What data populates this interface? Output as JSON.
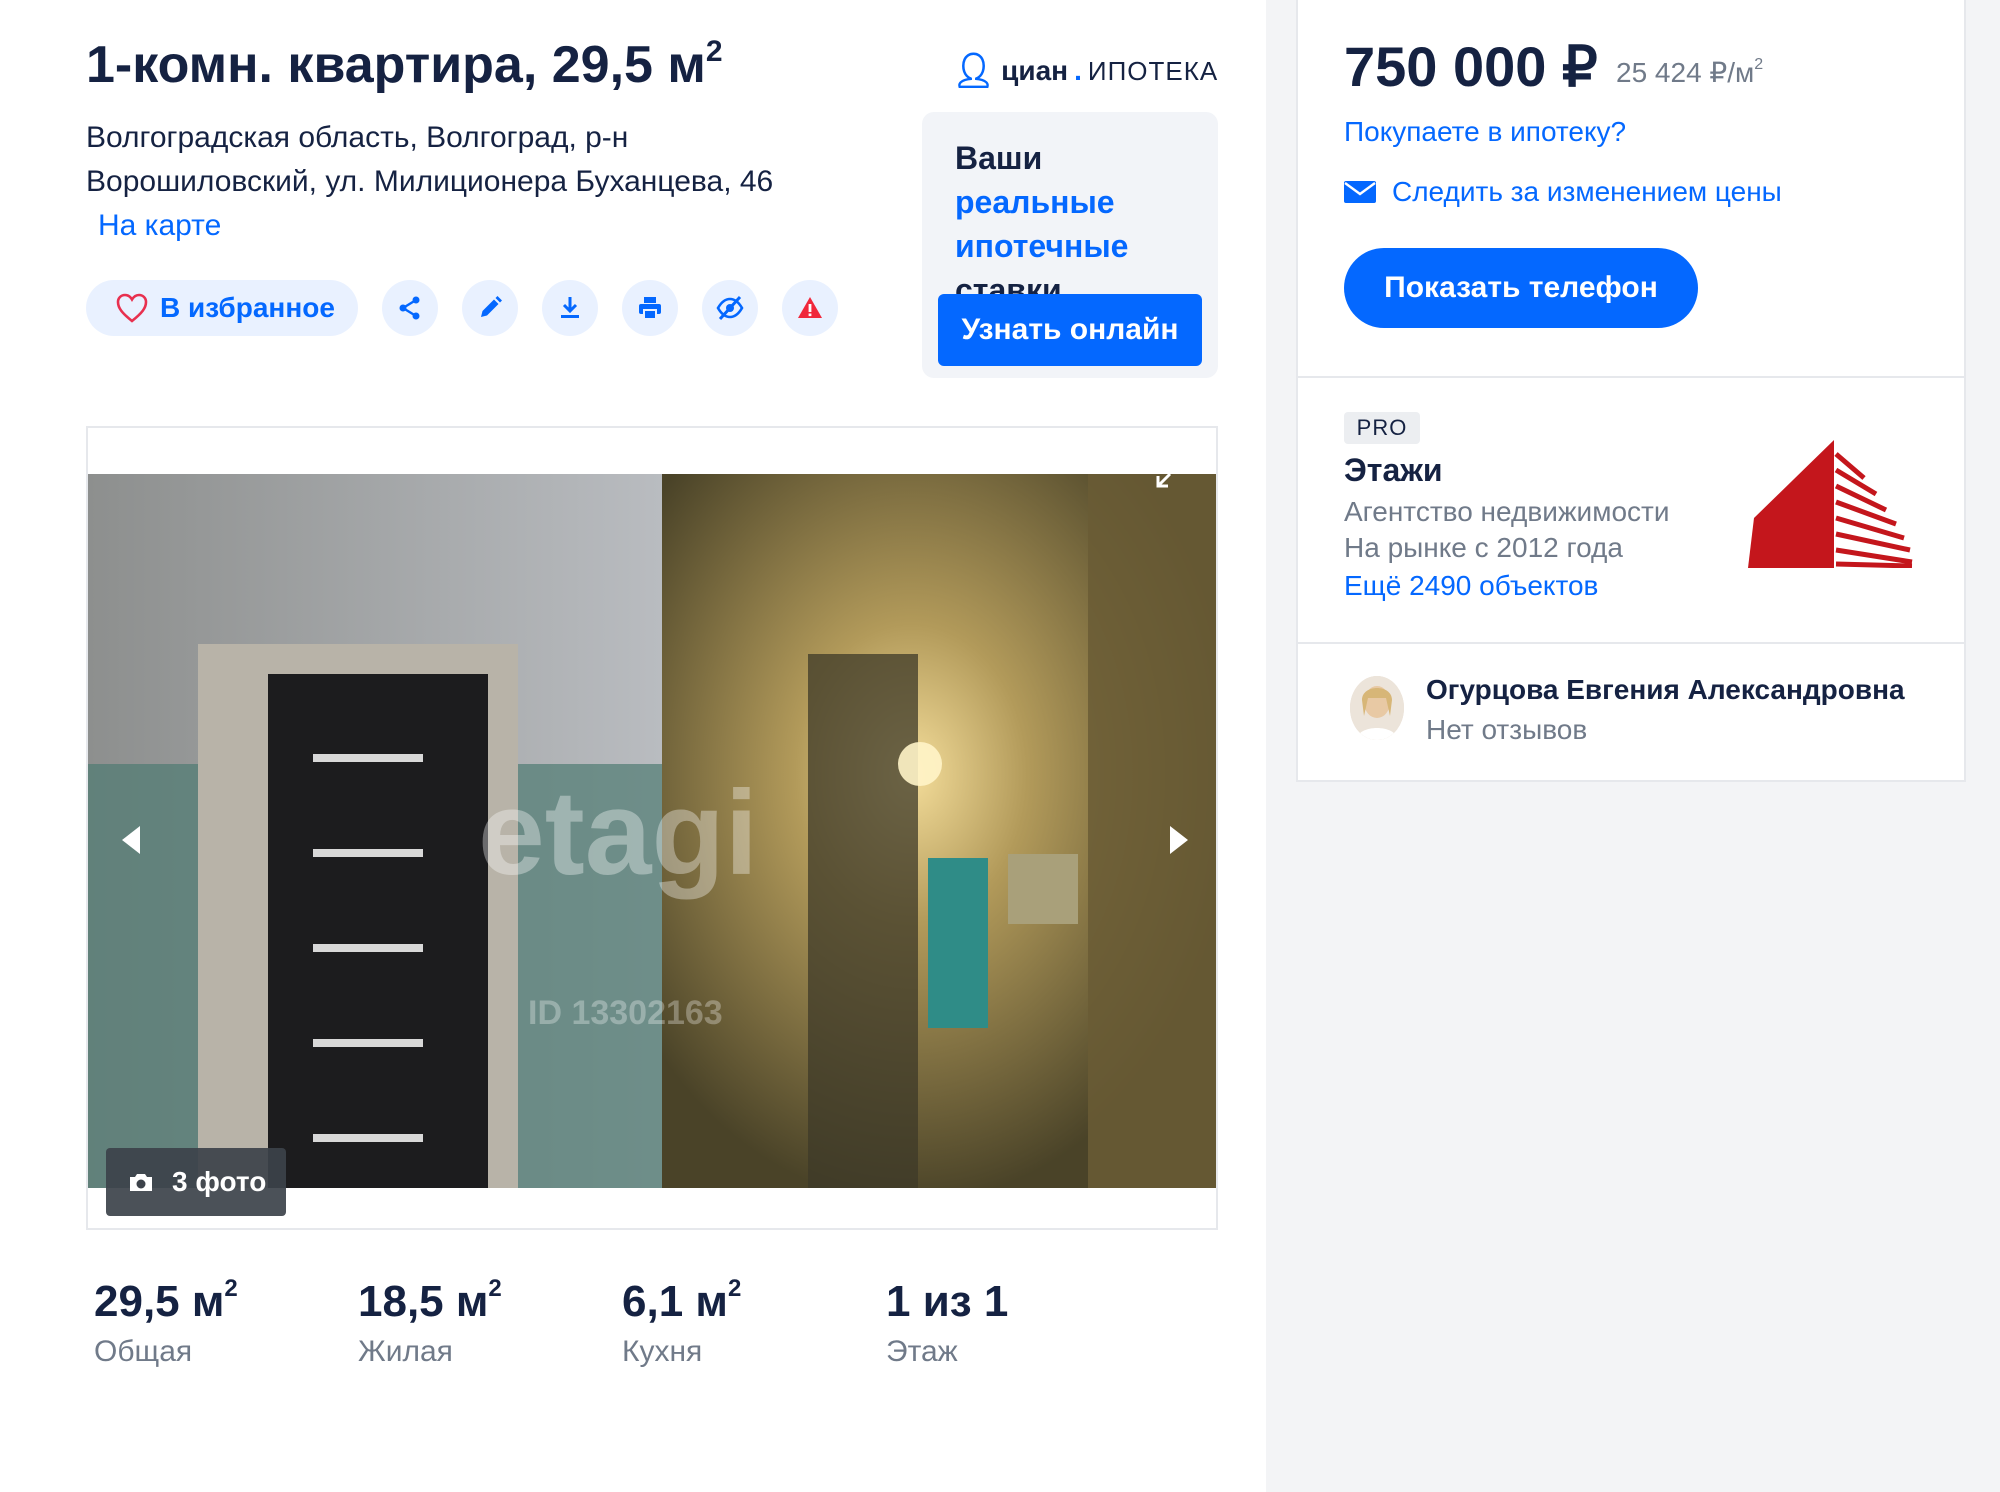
{
  "listing": {
    "title": "1-комн. квартира, 29,5 м",
    "title_sup": "2",
    "address": "Волгоградская область, Волгоград, р-н Ворошиловский, ул. Милиционера Буханцева, 46",
    "map_link": "На карте",
    "favorite_label": "В избранное",
    "actions": [
      "share-icon",
      "edit-icon",
      "download-icon",
      "print-icon",
      "hide-icon",
      "report-icon"
    ]
  },
  "ad": {
    "logo_brand": "циан",
    "logo_suffix": "ипотека",
    "text_1": "Ваши",
    "text_accent": "реальные ипотечные",
    "text_2": "ставки",
    "button": "Узнать онлайн"
  },
  "gallery": {
    "watermark": "etagi",
    "watermark_id": "ID 13302163",
    "photo_count": "3 фото"
  },
  "stats": [
    {
      "value": "29,5 м",
      "sup": "2",
      "label": "Общая"
    },
    {
      "value": "18,5 м",
      "sup": "2",
      "label": "Жилая"
    },
    {
      "value": "6,1 м",
      "sup": "2",
      "label": "Кухня"
    },
    {
      "value": "1 из 1",
      "sup": "",
      "label": "Этаж"
    }
  ],
  "sidebar": {
    "price": "750 000 ₽",
    "price_per_m": "25 424 ₽/м",
    "price_per_m_sup": "2",
    "mortgage_link": "Покупаете в ипотеку?",
    "watch_price": "Следить за изменением цены",
    "phone_button": "Показать телефон",
    "agency": {
      "badge": "PRO",
      "name": "Этажи",
      "type": "Агентство недвижимости",
      "since": "На рынке с 2012 года",
      "more": "Ещё 2490 объектов"
    },
    "agent": {
      "name": "Огурцова Евгения Александровна",
      "reviews": "Нет отзывов"
    }
  },
  "colors": {
    "accent": "#0468ff",
    "text": "#152242",
    "muted": "#707a89",
    "agency_logo": "#c4161c"
  }
}
